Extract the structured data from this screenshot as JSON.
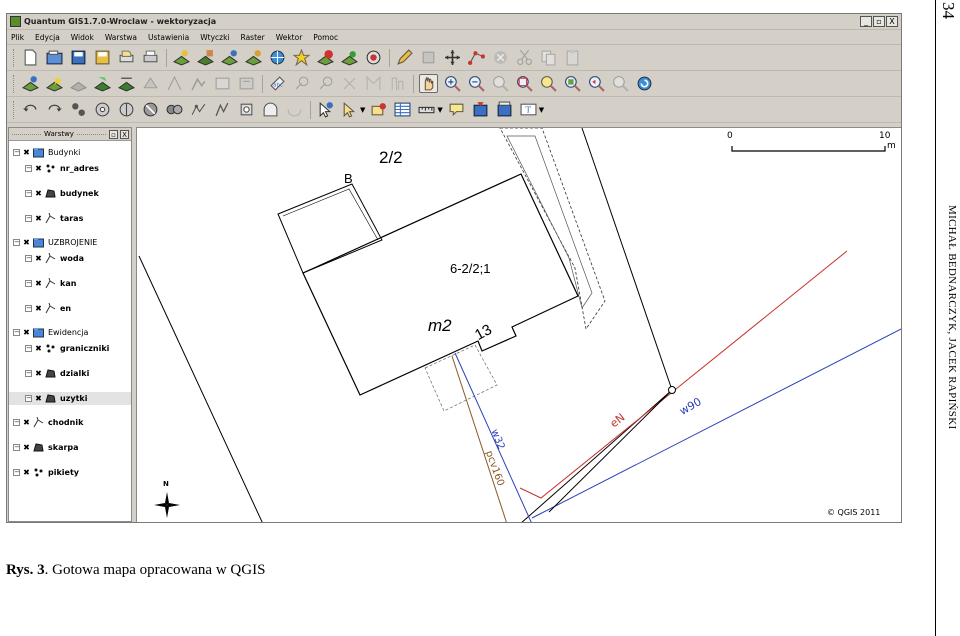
{
  "page": {
    "number": "34",
    "running_header": "MICHAŁ BEDNARCZYK, JACEK RAPIŃSKI",
    "caption_label": "Rys. 3",
    "caption_text": ". Gotowa mapa opracowana w QGIS"
  },
  "window": {
    "title": "Quantum GIS1.7.0-Wroclaw - wektoryzacja",
    "controls": [
      "_",
      "̲❐",
      "X"
    ]
  },
  "menu": [
    "Plik",
    "Edycja",
    "Widok",
    "Warstwa",
    "Ustawienia",
    "Wtyczki",
    "Raster",
    "Wektor",
    "Pomoc"
  ],
  "layers_panel": {
    "title": "Warstwy",
    "groups": [
      {
        "name": "Budynki",
        "children": [
          "nr_adres",
          "budynek",
          "taras"
        ]
      },
      {
        "name": "UZBROJENIE",
        "children": [
          "woda",
          "kan",
          "en"
        ]
      },
      {
        "name": "Ewidencja",
        "children": [
          "graniczniki",
          "dzialki",
          "uzytki"
        ]
      }
    ],
    "standalone": [
      "chodnik",
      "skarpa",
      "pikiety"
    ],
    "selected": "uzytki",
    "checked_mark": "✖"
  },
  "map": {
    "parcel_label": "2/2",
    "building_class_label": "B",
    "building_id_label": "6-2/2;1",
    "landuse_label": "m2",
    "storeys_label": "13",
    "scale_min": "0",
    "scale_max": "10",
    "scale_unit": "m",
    "north_label": "N",
    "line_labels": {
      "w32": "w32",
      "pcv160": "pcv160",
      "eN": "eN",
      "w90": "w90"
    },
    "copyright": "© QGIS 2011",
    "colors": {
      "water": "#2a3fb8",
      "electric": "#c8322a",
      "sewer": "#8a5a2a",
      "lines": "#000000"
    }
  }
}
